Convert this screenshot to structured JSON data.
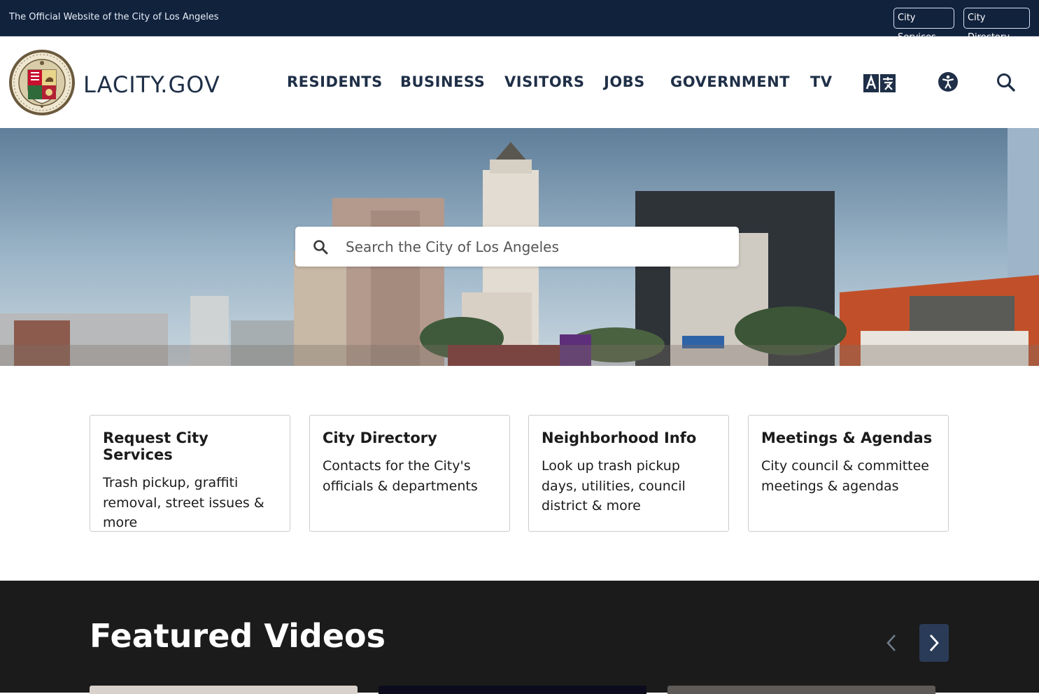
{
  "topbar": {
    "official_text": "The Official Website of the City of Los Angeles",
    "city_services": "City Services",
    "city_directory": "City Directory"
  },
  "header": {
    "brand": "LACITY.GOV",
    "seal_text": "CITY OF LOS ANGELES · FOUNDED 1781",
    "nav": {
      "residents": "RESIDENTS",
      "business": "BUSINESS",
      "visitors": "VISITORS",
      "jobs": "JOBS",
      "government": "GOVERNMENT",
      "tv": "TV"
    },
    "icons": [
      "translate-icon",
      "accessibility-icon",
      "search-icon"
    ]
  },
  "hero": {
    "search_placeholder": "Search the City of Los Angeles"
  },
  "cards": [
    {
      "title": "Request City Services",
      "desc": "Trash pickup, graffiti removal, street issues & more"
    },
    {
      "title": "City Directory",
      "desc": "Contacts for the City's officials & departments"
    },
    {
      "title": "Neighborhood Info",
      "desc": "Look up trash pickup days, utilities, council district & more"
    },
    {
      "title": "Meetings & Agendas",
      "desc": "City council & committee meetings & agendas"
    }
  ],
  "videos": {
    "heading": "Featured Videos"
  },
  "colors": {
    "topbar": "#11223d",
    "brand_text": "#1f2f47",
    "videos_bg": "#1b1b1b",
    "carousel_btn": "#2a3b57"
  }
}
